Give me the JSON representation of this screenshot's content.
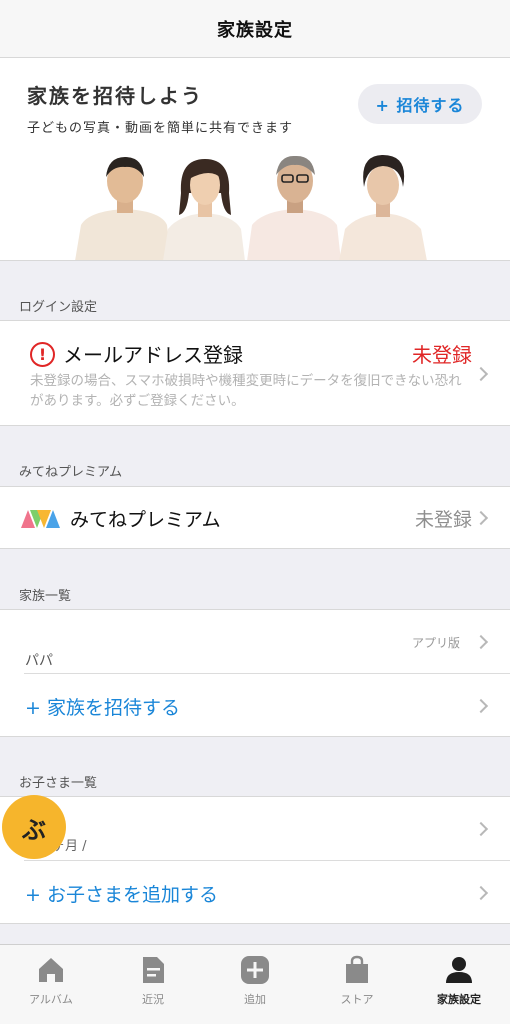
{
  "header": {
    "title": "家族設定"
  },
  "invite": {
    "title": "家族を招待しよう",
    "subtitle": "子どもの写真・動画を簡単に共有できます",
    "button_label": "+ 招待する"
  },
  "login_section": {
    "label": "ログイン設定",
    "email_title": "メールアドレス登録",
    "email_status": "未登録",
    "email_note": "未登録の場合、スマホ破損時や機種変更時にデータを復旧できない恐れがあります。必ずご登録ください。"
  },
  "premium_section": {
    "label": "みてねプレミアム",
    "title": "みてねプレミアム",
    "status": "未登録"
  },
  "family_section": {
    "label": "家族一覧",
    "member_app": "アプリ版",
    "member_name": "パパ",
    "invite_link": "+ 家族を招待する"
  },
  "children_section": {
    "label": "お子さま一覧",
    "child_initial": "ぶ",
    "child_age": "ヶ月 /",
    "add_link": "+ お子さまを追加する"
  },
  "tabbar": {
    "tabs": [
      {
        "label": "アルバム",
        "icon": "home-icon"
      },
      {
        "label": "近況",
        "icon": "document-icon"
      },
      {
        "label": "追加",
        "icon": "plus-icon"
      },
      {
        "label": "ストア",
        "icon": "shopping-bag-icon"
      },
      {
        "label": "家族設定",
        "icon": "person-icon"
      }
    ],
    "active_index": 4
  },
  "colors": {
    "accent": "#1a86d8",
    "alert": "#e02626",
    "badge": "#f6b52c"
  }
}
